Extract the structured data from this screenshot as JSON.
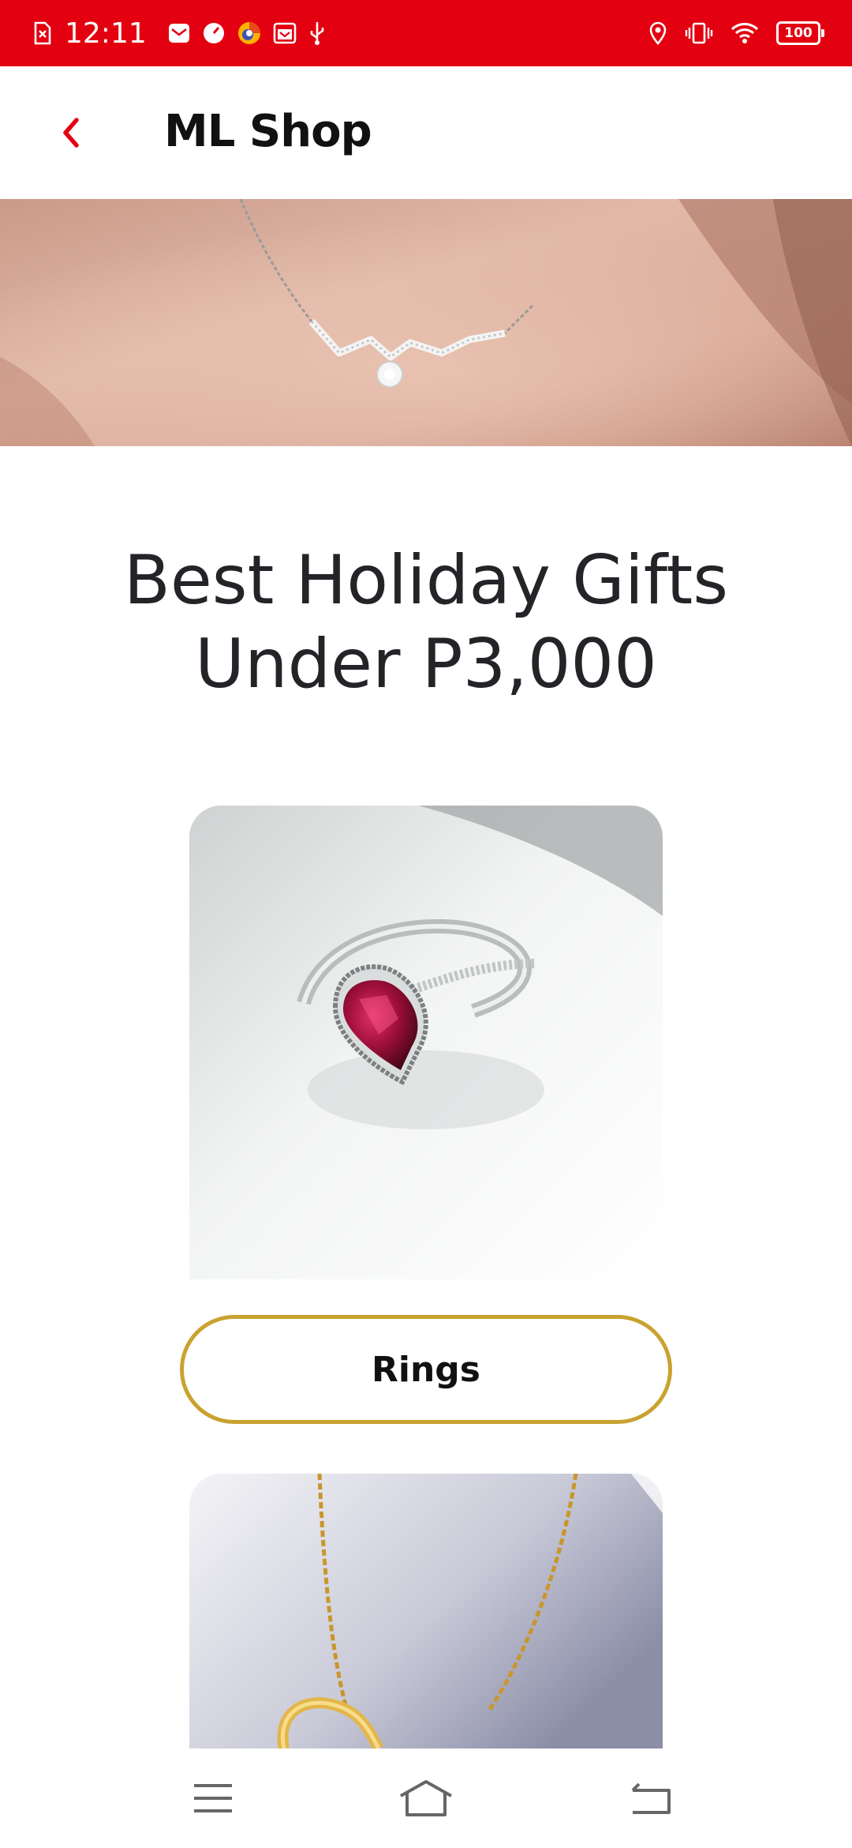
{
  "status_bar": {
    "time": "12:11",
    "battery_level": "100",
    "left_icons": [
      "sim-error-icon",
      "mail-icon",
      "speed-icon",
      "browser-icon",
      "calendar-icon",
      "usb-icon"
    ],
    "right_icons": [
      "location-icon",
      "vibrate-icon",
      "wifi-icon",
      "battery-icon"
    ],
    "background_color": "#e30010"
  },
  "app_bar": {
    "title": "ML Shop",
    "back_icon": "chevron-left-icon",
    "accent_color": "#e30010"
  },
  "hero": {
    "image": "necklace-banner-photo"
  },
  "headline": "Best Holiday Gifts Under P3,000",
  "categories": [
    {
      "label": "Rings",
      "image": "ruby-ring-photo"
    },
    {
      "label": "",
      "image": "gold-heart-necklace-photo"
    }
  ],
  "pill_border_color": "#c9a22f",
  "nav_bar": {
    "buttons": [
      "menu-icon",
      "home-icon",
      "back-icon"
    ]
  }
}
